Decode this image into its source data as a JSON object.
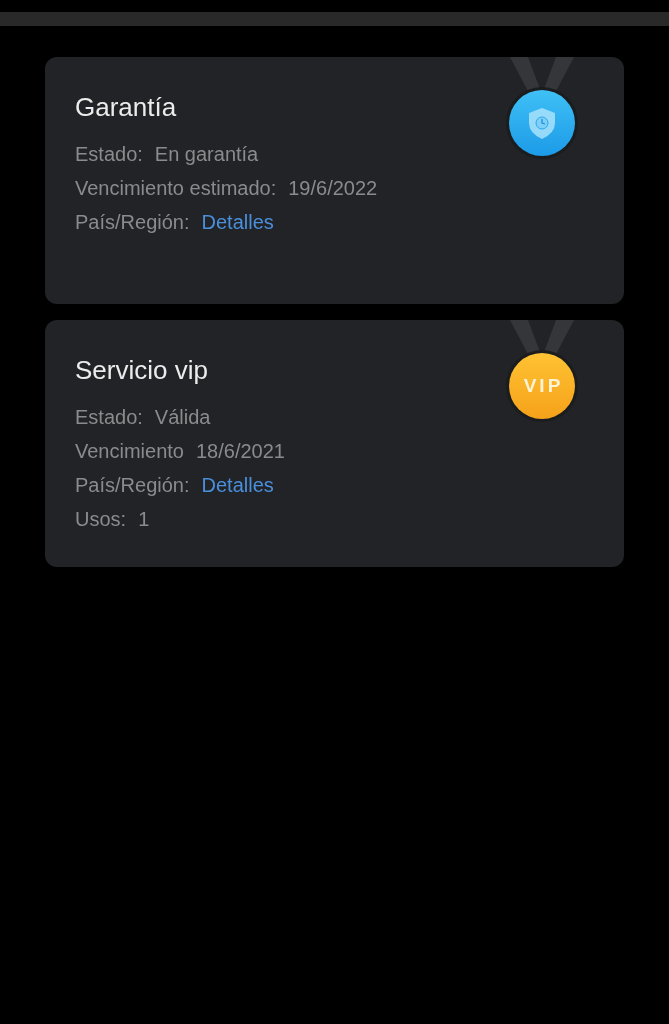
{
  "cards": [
    {
      "title": "Garantía",
      "medal": {
        "kind": "shield"
      },
      "rows": [
        {
          "label": "Estado:",
          "value": "En garantía",
          "kind": "text"
        },
        {
          "label": "Vencimiento estimado:",
          "value": "19/6/2022",
          "kind": "text"
        },
        {
          "label": "País/Región:",
          "value": "Detalles",
          "kind": "link"
        }
      ]
    },
    {
      "title": "Servicio vip",
      "medal": {
        "kind": "vip",
        "text": "VIP"
      },
      "rows": [
        {
          "label": "Estado:",
          "value": "Válida",
          "kind": "text"
        },
        {
          "label": "Vencimiento",
          "value": "18/6/2021",
          "kind": "text"
        },
        {
          "label": "País/Región:",
          "value": "Detalles",
          "kind": "link"
        },
        {
          "label": "Usos:",
          "value": "1",
          "kind": "text"
        }
      ]
    }
  ]
}
